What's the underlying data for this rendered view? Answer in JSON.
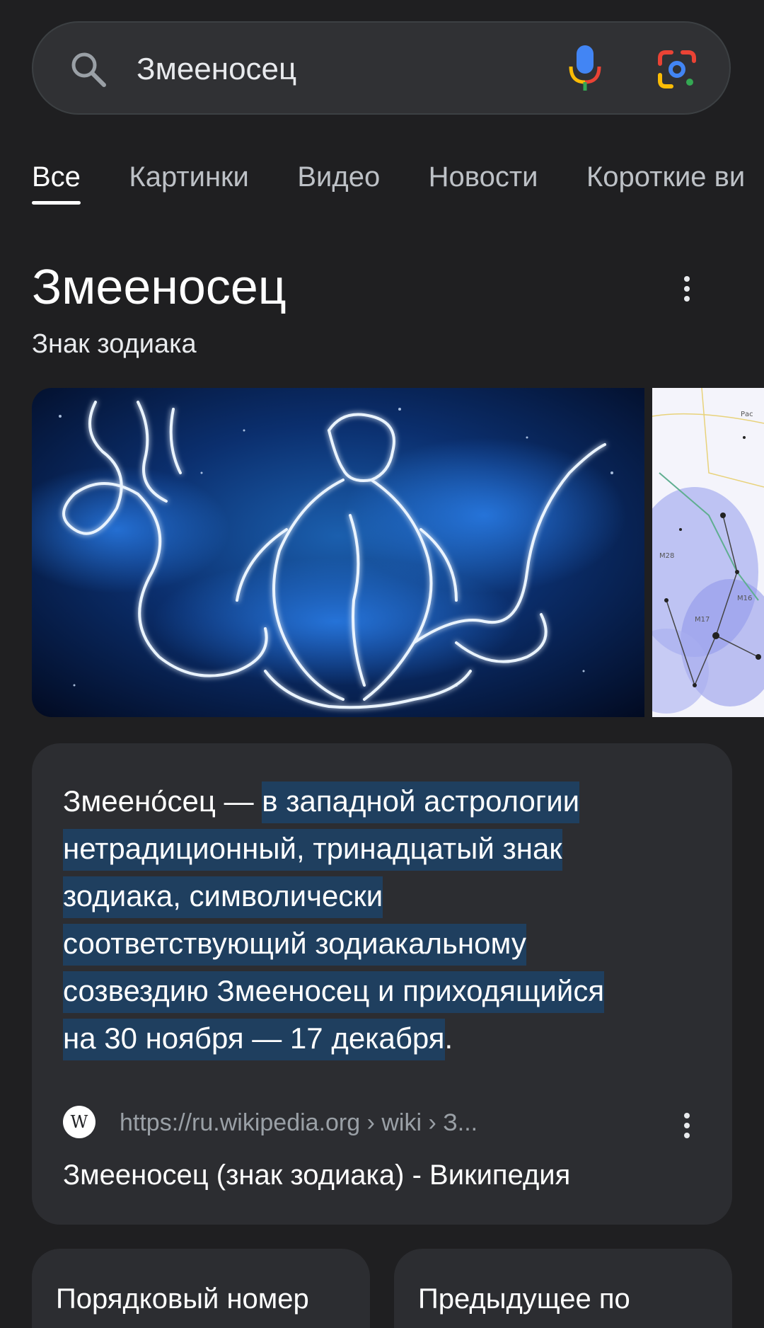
{
  "search": {
    "query": "Змееносец"
  },
  "tabs": [
    {
      "label": "Все",
      "active": true
    },
    {
      "label": "Картинки",
      "active": false
    },
    {
      "label": "Видео",
      "active": false
    },
    {
      "label": "Новости",
      "active": false
    },
    {
      "label": "Короткие ви",
      "active": false
    }
  ],
  "knowledge_panel": {
    "title": "Змееносец",
    "subtitle": "Знак зодиака"
  },
  "description": {
    "lead": "Змеено́сец — ",
    "highlight_lines": [
      "в западной астрологии",
      "нетрадиционный, тринадцатый знак",
      "зодиака, символически",
      "соответствующий зодиакальному",
      "созвездию Змееносец и приходящийся",
      "на 30 ноября — 17 декабря"
    ],
    "tail": "."
  },
  "source": {
    "favicon_letter": "W",
    "url": "https://ru.wikipedia.org › wiki › З...",
    "title": "Змееносец (знак зодиака) - Википедия"
  },
  "cards": [
    {
      "label": "Порядковый номер"
    },
    {
      "label": "Предыдущее по порядку"
    }
  ],
  "colors": {
    "background": "#1f1f21",
    "card": "#2c2d31",
    "highlight": "#1f3f5f",
    "mic_blue": "#4285f4",
    "mic_red": "#ea4335",
    "mic_yellow": "#fbbc05",
    "mic_green": "#34a853"
  }
}
